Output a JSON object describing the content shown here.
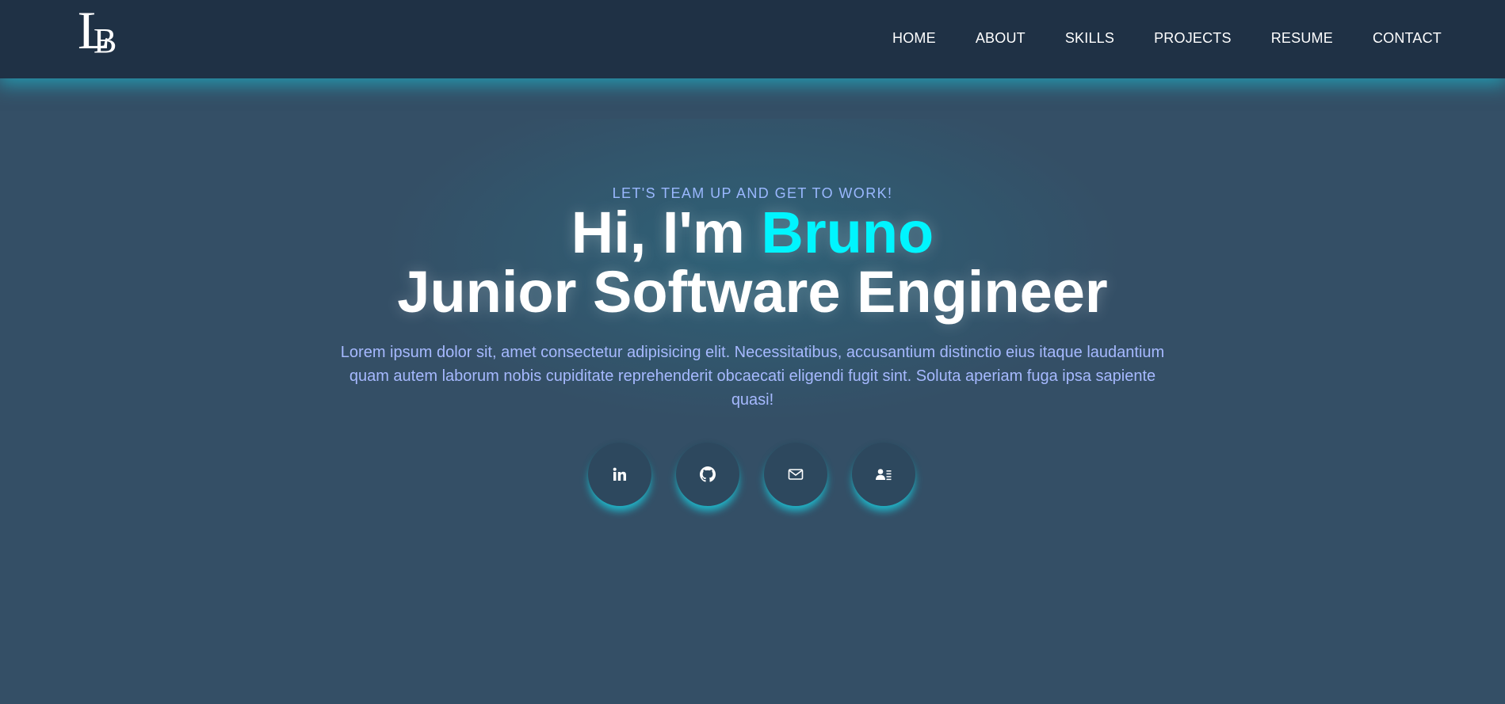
{
  "header": {
    "logo": {
      "letter_l": "L",
      "letter_b": "B"
    },
    "nav": [
      {
        "label": "HOME"
      },
      {
        "label": "ABOUT"
      },
      {
        "label": "SKILLS"
      },
      {
        "label": "PROJECTS"
      },
      {
        "label": "RESUME"
      },
      {
        "label": "CONTACT"
      }
    ]
  },
  "hero": {
    "tagline": "LET'S TEAM UP AND GET TO WORK!",
    "greeting": "Hi, I'm ",
    "name": "Bruno",
    "role": "Junior Software Engineer",
    "intro": "Lorem ipsum dolor sit, amet consectetur adipisicing elit. Necessitatibus, accusantium distinctio eius itaque laudantium quam autem laborum nobis cupiditate reprehenderit obcaecati eligendi fugit sint. Soluta aperiam fuga ipsa sapiente quasi!"
  },
  "socials": [
    {
      "icon": "linkedin-icon"
    },
    {
      "icon": "github-icon"
    },
    {
      "icon": "mail-icon"
    },
    {
      "icon": "contact-card-icon"
    }
  ],
  "colors": {
    "background": "#344f66",
    "header": "#1f3145",
    "accent": "#00f5ff",
    "text_soft": "#a6b9ff",
    "glow": "#18d2e8"
  }
}
